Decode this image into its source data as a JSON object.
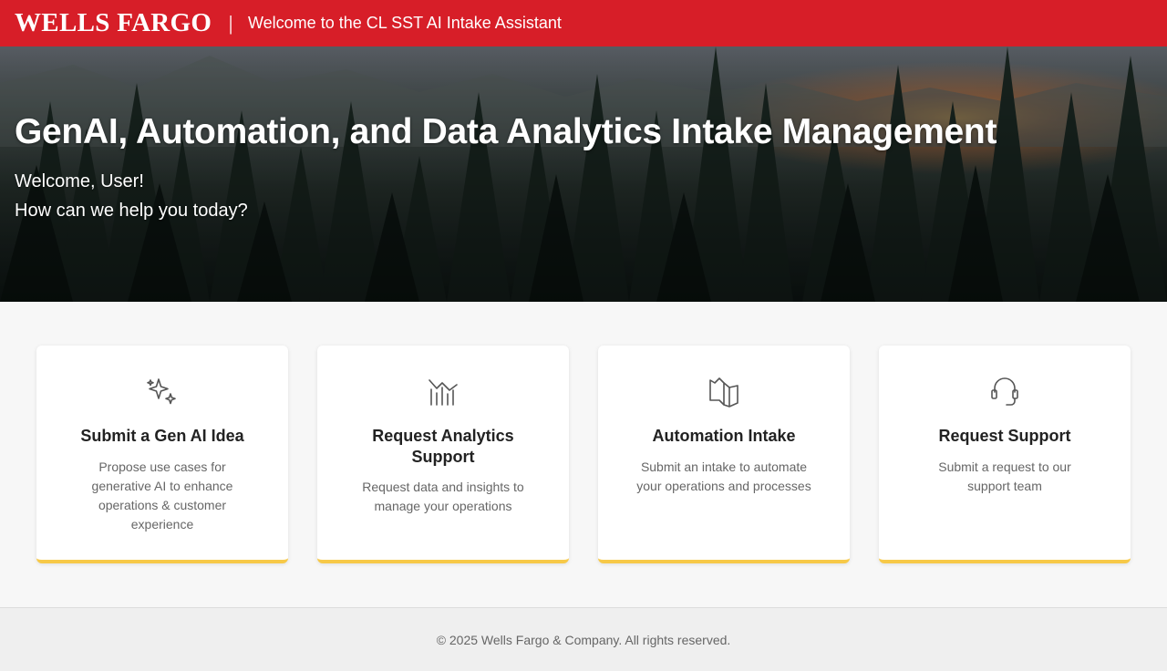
{
  "header": {
    "logo": "WELLS FARGO",
    "separator": "|",
    "tagline": "Welcome to the CL SST AI Intake Assistant"
  },
  "hero": {
    "title": "GenAI, Automation, and Data Analytics Intake Management",
    "welcome": "Welcome, User!",
    "prompt": "How can we help you today?"
  },
  "cards": [
    {
      "icon": "sparkles-icon",
      "title": "Submit a Gen AI Idea",
      "description": "Propose use cases for generative AI to enhance operations & customer experience"
    },
    {
      "icon": "analytics-chart-icon",
      "title": "Request Analytics Support",
      "description": "Request data and insights to manage your operations"
    },
    {
      "icon": "automation-icon",
      "title": "Automation Intake",
      "description": "Submit an intake to automate your operations and processes"
    },
    {
      "icon": "headset-icon",
      "title": "Request Support",
      "description": "Submit a request to our support team"
    }
  ],
  "footer": {
    "copyright": "© 2025 Wells Fargo & Company. All rights reserved."
  },
  "colors": {
    "brand_red": "#d71e28",
    "accent_yellow": "#f7c948"
  }
}
